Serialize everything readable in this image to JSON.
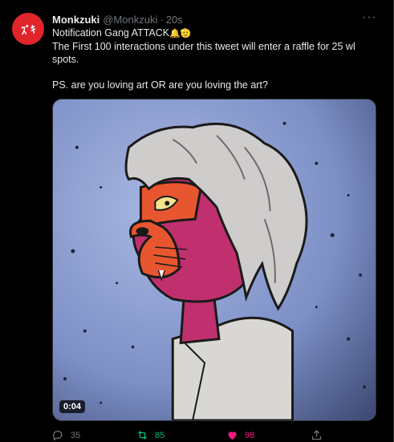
{
  "tweet": {
    "author_name": "Monkzuki",
    "handle": "@Monkzuki",
    "separator": "·",
    "time": "20s",
    "avatar_text": "ｽﾞｷ",
    "more_label": "···",
    "text_line1": "Notification Gang ATTACK",
    "text_line1_emoji": "🔔🫡",
    "text_line2": "The First 100 interactions under this tweet will enter a raffle for 25 wl spots.",
    "text_line3": "PS. are you loving art OR are you loving the art?",
    "media": {
      "duration": "0:04"
    },
    "actions": {
      "reply_count": "35",
      "retweet_count": "85",
      "like_count": "98"
    }
  },
  "colors": {
    "background": "#000000",
    "text": "#e7e9ea",
    "muted": "#71767b",
    "retweet": "#00ba7c",
    "like": "#f91880",
    "avatar": "#e0252b"
  }
}
